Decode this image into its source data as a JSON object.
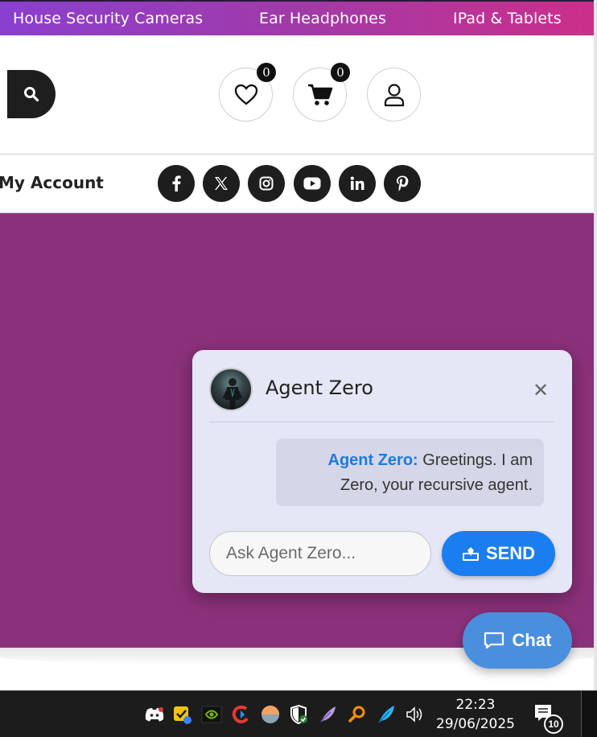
{
  "category_nav": [
    "House Security Cameras",
    "Ear Headphones",
    "IPad & Tablets"
  ],
  "header": {
    "search_icon": "search-icon",
    "wishlist_count": "0",
    "cart_count": "0",
    "user_icon": "user-icon"
  },
  "nav": {
    "my_account": "My Account",
    "social": [
      "facebook-icon",
      "x-icon",
      "instagram-icon",
      "youtube-icon",
      "linkedin-icon",
      "pinterest-icon"
    ]
  },
  "colors": {
    "hero_bg": "#8b317b",
    "send_button": "#1b7ef0",
    "agent_name": "#1a7be0"
  },
  "chat": {
    "title": "Agent Zero",
    "message_author": "Agent Zero:",
    "message_text": "Greetings. I am Zero, your recursive agent.",
    "input_placeholder": "Ask Agent Zero...",
    "send_label": "SEND",
    "fab_label": "Chat"
  },
  "taskbar": {
    "time": "22:23",
    "date": "29/06/2025",
    "notification_count": "10"
  }
}
